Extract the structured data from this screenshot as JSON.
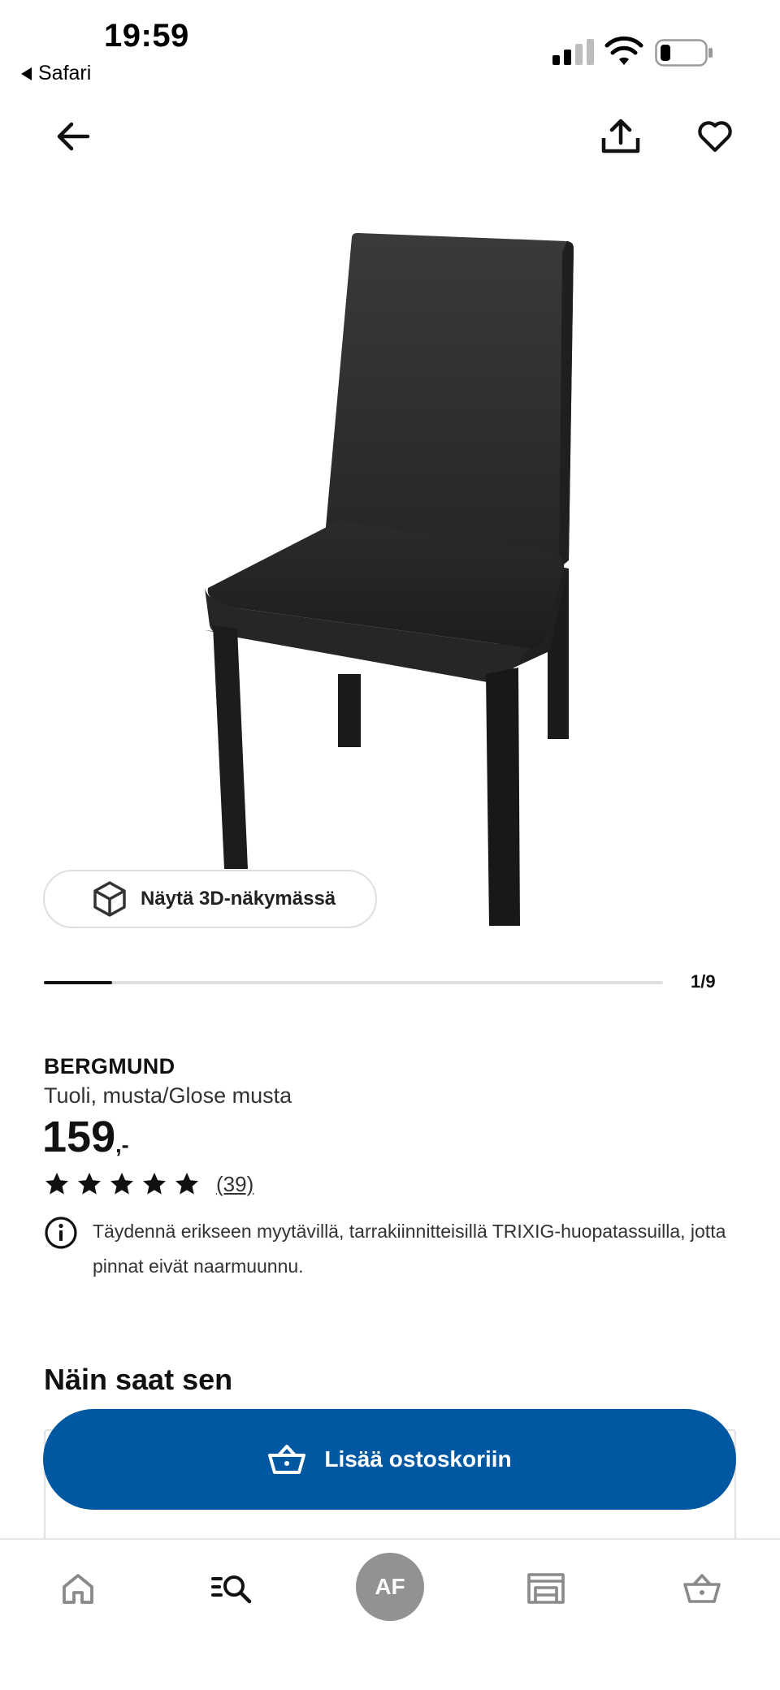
{
  "status_bar": {
    "time": "19:59",
    "back_app": "Safari"
  },
  "top_nav": {
    "icons": [
      "arrow-left-icon",
      "share-icon",
      "heart-icon"
    ]
  },
  "gallery": {
    "view_3d_label": "Näytä 3D-näkymässä",
    "current_page": "1/9",
    "progress_fraction": 0.11
  },
  "product": {
    "name": "BERGMUND",
    "description": "Tuoli, musta/Glose musta",
    "price_integer": "159",
    "price_suffix": ",-",
    "rating_stars": 5,
    "review_count": "(39)",
    "info_note": "Täydennä erikseen myytävillä, tarrakiinnitteisillä TRIXIG-huopatassuilla, jotta pinnat eivät naarmuunnu."
  },
  "availability": {
    "section_title": "Näin saat sen",
    "status_color": "#0a8a00"
  },
  "cart_button": {
    "label": "Lisää ostoskoriin",
    "color": "#0058a3"
  },
  "tabbar": {
    "profile_initials": "AF",
    "icons": [
      "home-icon",
      "search-list-icon",
      "profile-avatar",
      "store-icon",
      "basket-icon"
    ]
  }
}
